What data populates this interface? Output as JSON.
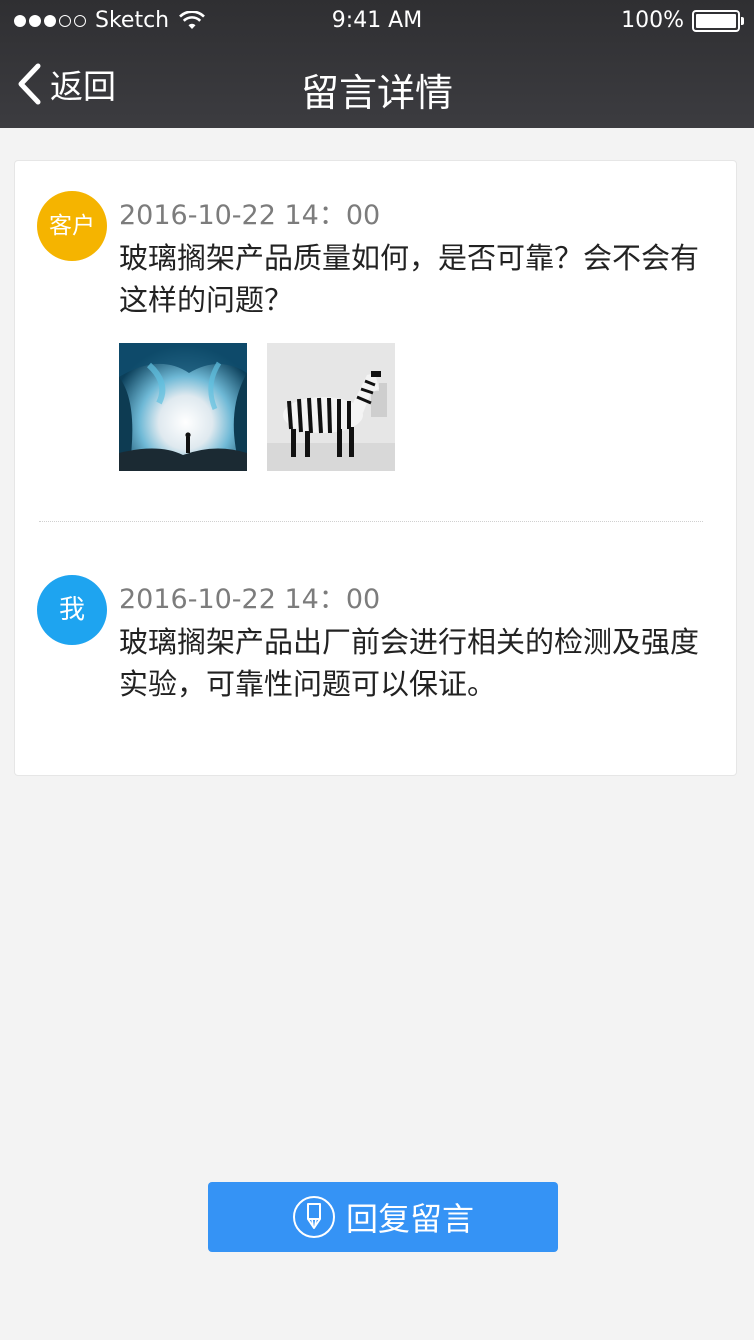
{
  "status_bar": {
    "carrier": "Sketch",
    "time": "9:41 AM",
    "battery": "100%"
  },
  "nav": {
    "back_label": "返回",
    "title": "留言详情"
  },
  "messages": [
    {
      "avatar": "客户",
      "avatar_color": "#f5b400",
      "timestamp": "2016-10-22 14：00",
      "text": "玻璃搁架产品质量如何，是否可靠？会不会有这样的问题？",
      "images": [
        "ice-cave-photo",
        "zebra-photo"
      ]
    },
    {
      "avatar": "我",
      "avatar_color": "#1ea4f0",
      "timestamp": "2016-10-22 14：00",
      "text": "玻璃搁架产品出厂前会进行相关的检测及强度实验，可靠性问题可以保证。"
    }
  ],
  "reply_button": {
    "label": "回复留言",
    "icon": "pencil-icon",
    "color": "#3593f5"
  }
}
